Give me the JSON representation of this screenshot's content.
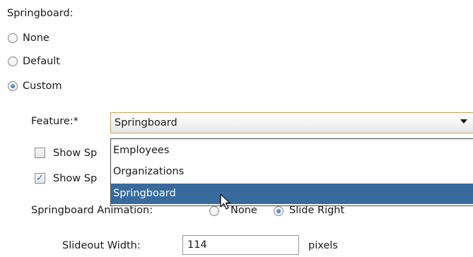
{
  "springboard": {
    "label": "Springboard:",
    "options": [
      {
        "label": "None",
        "checked": false
      },
      {
        "label": "Default",
        "checked": false
      },
      {
        "label": "Custom",
        "checked": true
      }
    ]
  },
  "feature": {
    "label": "Feature:*",
    "selected": "Springboard",
    "dropdown_options": [
      "Employees",
      "Organizations",
      "Springboard"
    ],
    "highlighted_option": "Springboard"
  },
  "checkboxes": [
    {
      "label": "Show Sp",
      "checked": false
    },
    {
      "label": "Show Sp",
      "checked": true
    }
  ],
  "animation": {
    "label": "Springboard Animation:",
    "options": [
      {
        "label": "None",
        "checked": false
      },
      {
        "label": "Slide Right",
        "checked": true
      }
    ]
  },
  "slideout": {
    "label": "Slideout Width:",
    "value": "114",
    "unit": "pixels"
  },
  "icons": {
    "cursor": "arrow-pointer-icon",
    "combo_arrow": "chevron-down-icon"
  },
  "colors": {
    "selection": "#396a9e",
    "combo_border": "#c9a25a"
  }
}
